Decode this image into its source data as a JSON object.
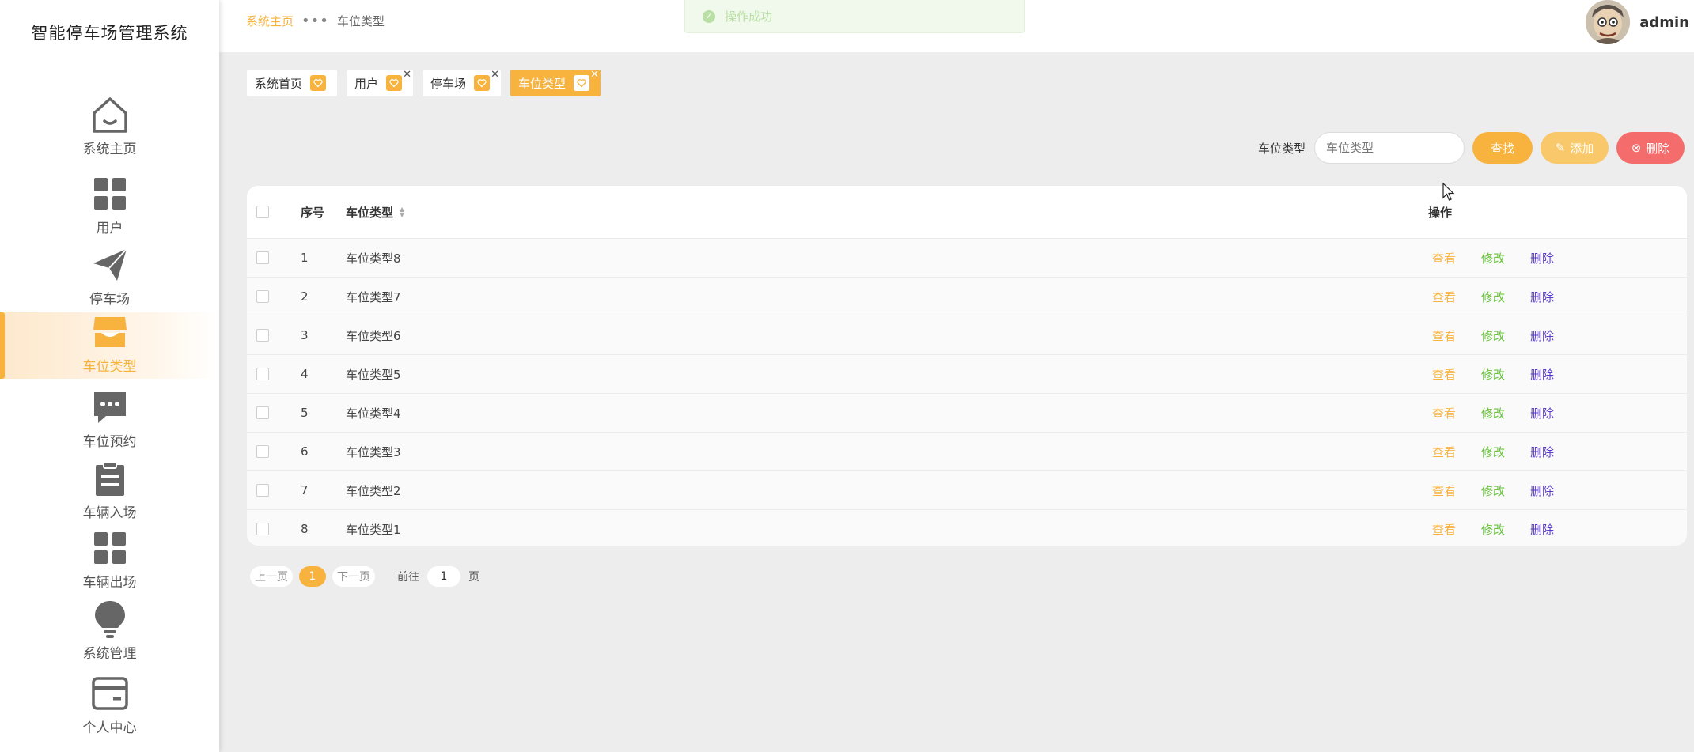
{
  "brand": "智能停车场管理系统",
  "sidebar": {
    "items": [
      {
        "label": "系统主页",
        "icon": "home-icon"
      },
      {
        "label": "用户",
        "icon": "grid-icon"
      },
      {
        "label": "停车场",
        "icon": "paper-plane-icon"
      },
      {
        "label": "车位类型",
        "icon": "shop-icon"
      },
      {
        "label": "车位预约",
        "icon": "chat-icon"
      },
      {
        "label": "车辆入场",
        "icon": "clipboard-icon"
      },
      {
        "label": "车辆出场",
        "icon": "grid-icon"
      },
      {
        "label": "系统管理",
        "icon": "bulb-icon"
      },
      {
        "label": "个人中心",
        "icon": "card-icon"
      }
    ],
    "active_index": 3
  },
  "breadcrumb": {
    "home": "系统主页",
    "sep": "•••",
    "current": "车位类型"
  },
  "toast": {
    "text": "操作成功"
  },
  "user": {
    "name": "admin"
  },
  "tags": [
    {
      "label": "系统首页",
      "closable": false
    },
    {
      "label": "用户",
      "closable": true
    },
    {
      "label": "停车场",
      "closable": true
    },
    {
      "label": "车位类型",
      "closable": true,
      "active": true
    }
  ],
  "search": {
    "label": "车位类型",
    "placeholder": "车位类型",
    "find_label": "查找",
    "add_label": "添加",
    "delete_label": "删除"
  },
  "table": {
    "headers": {
      "no": "序号",
      "type": "车位类型",
      "ops": "操作"
    },
    "ops": {
      "view": "查看",
      "edit": "修改",
      "delete": "删除"
    },
    "rows": [
      {
        "no": "1",
        "type": "车位类型8"
      },
      {
        "no": "2",
        "type": "车位类型7"
      },
      {
        "no": "3",
        "type": "车位类型6"
      },
      {
        "no": "4",
        "type": "车位类型5"
      },
      {
        "no": "5",
        "type": "车位类型4"
      },
      {
        "no": "6",
        "type": "车位类型3"
      },
      {
        "no": "7",
        "type": "车位类型2"
      },
      {
        "no": "8",
        "type": "车位类型1"
      }
    ]
  },
  "pagination": {
    "prev": "上一页",
    "page": "1",
    "next": "下一页",
    "goto_prefix": "前往",
    "goto_value": "1",
    "goto_suffix": "页"
  },
  "colors": {
    "accent": "#f7b33e",
    "edit": "#67c23a",
    "delete_link": "#5a3cc4",
    "danger": "#f56c6c"
  }
}
